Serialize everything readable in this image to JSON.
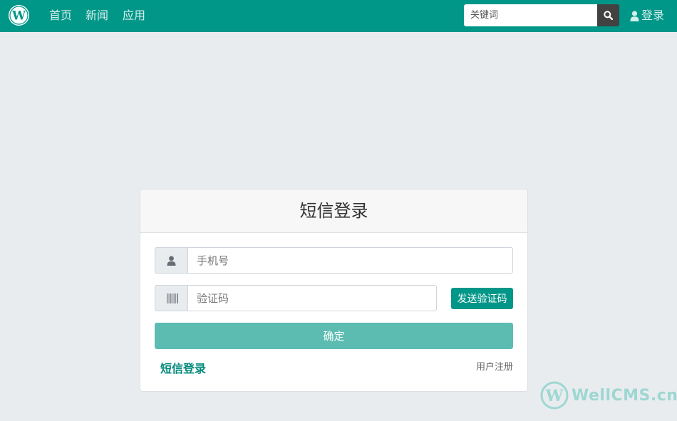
{
  "navbar": {
    "logo_letter": "W",
    "links": [
      "首页",
      "新闻",
      "应用"
    ],
    "search_placeholder": "关键词",
    "login_label": "登录"
  },
  "card": {
    "title": "短信登录",
    "phone_placeholder": "手机号",
    "code_placeholder": "验证码",
    "send_code_label": "发送验证码",
    "submit_label": "确定",
    "sms_login_label": "短信登录",
    "register_label": "用户注册"
  },
  "watermark": {
    "letter": "W",
    "text": "WellCMS.cn"
  },
  "colors": {
    "brand": "#009688",
    "submit": "#5cbcb2",
    "page_bg": "#e9ecef"
  },
  "icons": [
    "wordpress-logo-icon",
    "search-icon",
    "user-icon",
    "barcode-icon"
  ]
}
